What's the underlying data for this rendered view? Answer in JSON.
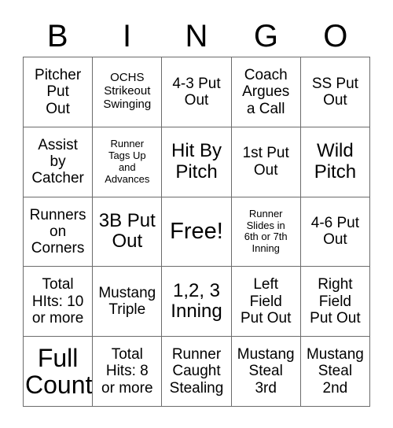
{
  "card": {
    "title": "BINGO",
    "header_letters": [
      "B",
      "I",
      "N",
      "G",
      "O"
    ],
    "rows": [
      [
        {
          "text": "Pitcher\nPut\nOut",
          "size": "md"
        },
        {
          "text": "OCHS\nStrikeout\nSwinging",
          "size": "sm"
        },
        {
          "text": "4-3 Put\nOut",
          "size": "md"
        },
        {
          "text": "Coach\nArgues\na Call",
          "size": "md"
        },
        {
          "text": "SS Put\nOut",
          "size": "md"
        }
      ],
      [
        {
          "text": "Assist\nby\nCatcher",
          "size": "md"
        },
        {
          "text": "Runner\nTags Up\nand\nAdvances",
          "size": "xs"
        },
        {
          "text": "Hit By\nPitch",
          "size": "lg"
        },
        {
          "text": "1st Put\nOut",
          "size": "md"
        },
        {
          "text": "Wild\nPitch",
          "size": "lg"
        }
      ],
      [
        {
          "text": "Runners\non\nCorners",
          "size": "md"
        },
        {
          "text": "3B Put\nOut",
          "size": "lg"
        },
        {
          "text": "Free!",
          "size": "xl"
        },
        {
          "text": "Runner\nSlides in\n6th or 7th\nInning",
          "size": "xs"
        },
        {
          "text": "4-6 Put\nOut",
          "size": "md"
        }
      ],
      [
        {
          "text": "Total\nHIts: 10\nor more",
          "size": "md"
        },
        {
          "text": "Mustang\nTriple",
          "size": "md"
        },
        {
          "text": "1,2, 3\nInning",
          "size": "lg"
        },
        {
          "text": "Left\nField\nPut Out",
          "size": "md"
        },
        {
          "text": "Right\nField\nPut Out",
          "size": "md"
        }
      ],
      [
        {
          "text": "Full\nCount",
          "size": "xxl"
        },
        {
          "text": "Total\nHits: 8\nor more",
          "size": "md"
        },
        {
          "text": "Runner\nCaught\nStealing",
          "size": "md"
        },
        {
          "text": "Mustang\nSteal\n3rd",
          "size": "md"
        },
        {
          "text": "Mustang\nSteal\n2nd",
          "size": "md"
        }
      ]
    ],
    "colors": {
      "background": "#ffffff",
      "text": "#000000",
      "grid_line": "#6b6b6b"
    }
  }
}
